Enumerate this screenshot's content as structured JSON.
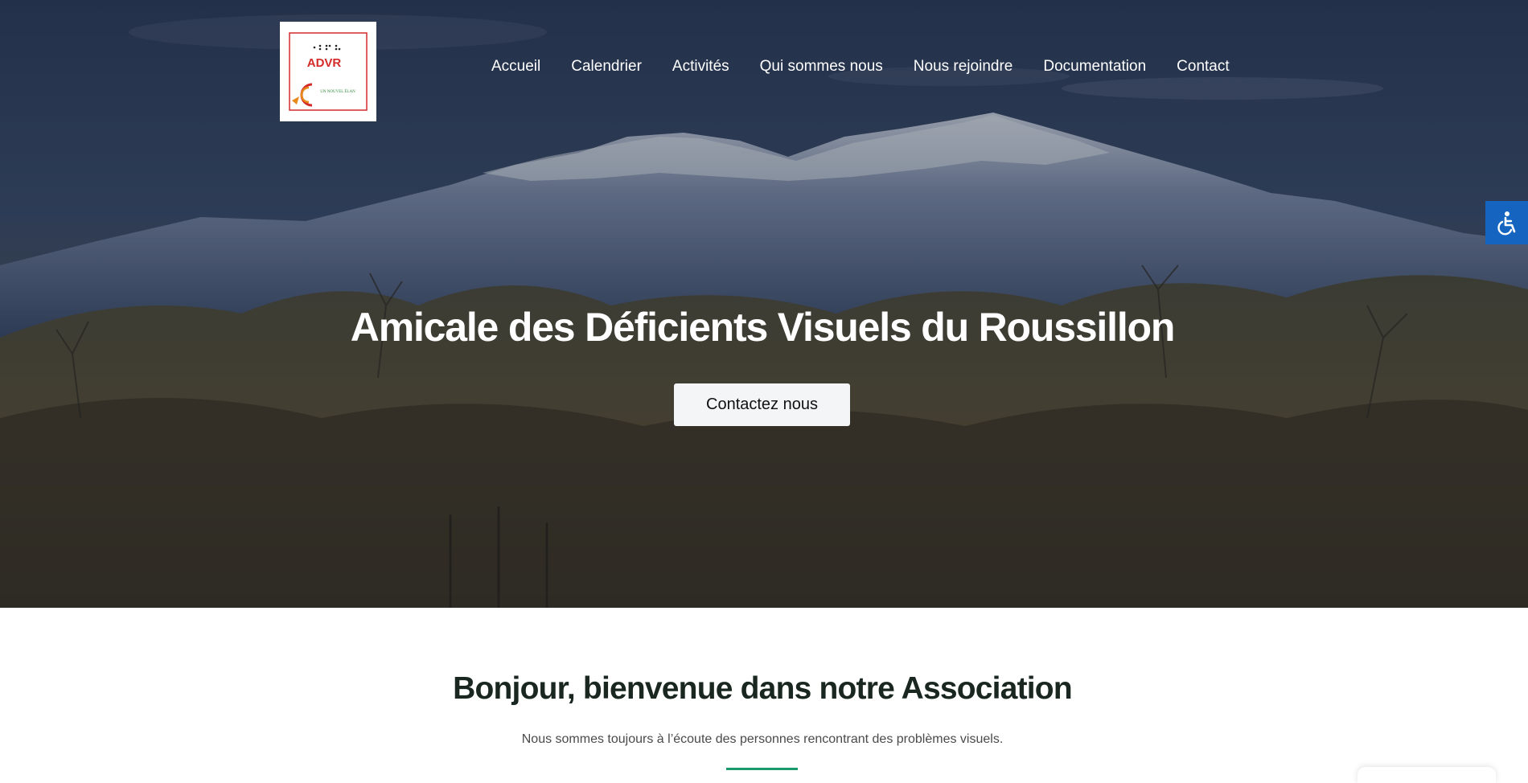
{
  "logo": {
    "text": "ADVR",
    "tagline": "UN NOUVEL ÉLAN"
  },
  "nav": {
    "items": [
      {
        "label": "Accueil"
      },
      {
        "label": "Calendrier"
      },
      {
        "label": "Activités"
      },
      {
        "label": "Qui sommes nous"
      },
      {
        "label": "Nous rejoindre"
      },
      {
        "label": "Documentation"
      },
      {
        "label": "Contact"
      }
    ]
  },
  "hero": {
    "title": "Amicale des Déficients Visuels du Roussillon",
    "cta_label": "Contactez nous"
  },
  "welcome": {
    "title": "Bonjour, bienvenue dans notre Association",
    "subtitle": "Nous sommes toujours à l’écoute des personnes rencontrant des problèmes visuels."
  },
  "icons": {
    "accessibility": "wheelchair-icon"
  },
  "colors": {
    "accessibility_button": "#1565c0",
    "divider": "#1a9a6c",
    "logo_red": "#d42a2a"
  }
}
